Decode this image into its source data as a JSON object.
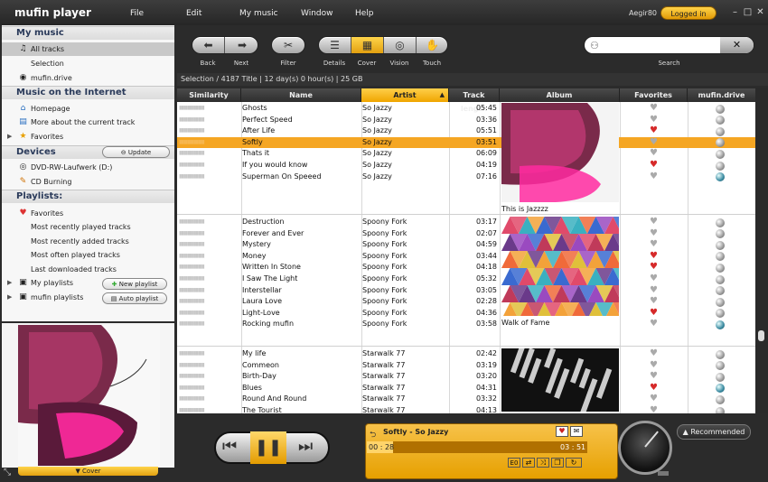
{
  "app": {
    "title": "mufin player",
    "user": "Aegir80",
    "logged_in": "Logged in"
  },
  "menu": [
    "File",
    "Edit",
    "My music",
    "Window",
    "Help"
  ],
  "toolbar": {
    "back": "Back",
    "next": "Next",
    "filter": "Filter",
    "details": "Details",
    "cover": "Cover",
    "vision": "Vision",
    "touch": "Touch",
    "search": "Search",
    "search_value": ""
  },
  "sidebar": {
    "my_music": "My music",
    "all_tracks": "All tracks",
    "selection": "Selection",
    "mufin_drive": "mufin.drive",
    "internet": "Music on the Internet",
    "homepage": "Homepage",
    "more_about": "More about the current track",
    "favorites": "Favorites",
    "devices": "Devices",
    "update": "Update",
    "dvd": "DVD-RW-Laufwerk (D:)",
    "cd": "CD Burning",
    "playlists": "Playlists:",
    "pl_favorites": "Favorites",
    "recent_played": "Most recently played tracks",
    "recent_added": "Most recently added tracks",
    "often_played": "Most often played tracks",
    "last_downloaded": "Last downloaded tracks",
    "my_playlists": "My playlists",
    "new_playlist": "New playlist",
    "mufin_playlists": "mufin playlists",
    "auto_playlist": "Auto playlist",
    "cover_label": "Cover"
  },
  "breadcrumb": [
    "Selection",
    "4187 Title",
    "12 day(s) 0 hour(s)",
    "25 GB"
  ],
  "columns": [
    "Similarity",
    "Name",
    "Artist",
    "Track length",
    "Album",
    "Favorites",
    "mufin.drive"
  ],
  "groups": [
    {
      "album": "This is Jazzzz",
      "tracks": [
        {
          "name": "Ghosts",
          "artist": "So Jazzy",
          "length": "05:45",
          "fav": false,
          "drive": "gray"
        },
        {
          "name": "Perfect Speed",
          "artist": "So Jazzy",
          "length": "03:36",
          "fav": false,
          "drive": "gray"
        },
        {
          "name": "After Life",
          "artist": "So Jazzy",
          "length": "05:51",
          "fav": true,
          "drive": "gray"
        },
        {
          "name": "Softly",
          "artist": "So Jazzy",
          "length": "03:51",
          "fav": false,
          "drive": "gray",
          "selected": true
        },
        {
          "name": "Thats it",
          "artist": "So Jazzy",
          "length": "06:09",
          "fav": false,
          "drive": "gray"
        },
        {
          "name": "If you would know",
          "artist": "So Jazzy",
          "length": "04:19",
          "fav": true,
          "drive": "gray"
        },
        {
          "name": "Superman On Speeed",
          "artist": "So Jazzy",
          "length": "07:16",
          "fav": false,
          "drive": "blue"
        }
      ]
    },
    {
      "album": "Walk of Fame",
      "tracks": [
        {
          "name": "Destruction",
          "artist": "Spoony Fork",
          "length": "03:17",
          "fav": false,
          "drive": "gray"
        },
        {
          "name": "Forever and Ever",
          "artist": "Spoony Fork",
          "length": "02:07",
          "fav": false,
          "drive": "gray"
        },
        {
          "name": "Mystery",
          "artist": "Spoony Fork",
          "length": "04:59",
          "fav": false,
          "drive": "gray"
        },
        {
          "name": "Money",
          "artist": "Spoony Fork",
          "length": "03:44",
          "fav": true,
          "drive": "gray"
        },
        {
          "name": "Written In Stone",
          "artist": "Spoony Fork",
          "length": "04:18",
          "fav": true,
          "drive": "gray"
        },
        {
          "name": "I Saw The Light",
          "artist": "Spoony Fork",
          "length": "05:32",
          "fav": false,
          "drive": "gray"
        },
        {
          "name": "Interstellar",
          "artist": "Spoony Fork",
          "length": "03:05",
          "fav": false,
          "drive": "gray"
        },
        {
          "name": "Laura Love",
          "artist": "Spoony Fork",
          "length": "02:28",
          "fav": false,
          "drive": "gray"
        },
        {
          "name": "Light-Love",
          "artist": "Spoony Fork",
          "length": "04:36",
          "fav": true,
          "drive": "gray"
        },
        {
          "name": "Rocking mufin",
          "artist": "Spoony Fork",
          "length": "03:58",
          "fav": false,
          "drive": "blue"
        }
      ]
    },
    {
      "album": "",
      "tracks": [
        {
          "name": "My life",
          "artist": "Starwalk 77",
          "length": "02:42",
          "fav": false,
          "drive": "gray"
        },
        {
          "name": "Commeon",
          "artist": "Starwalk 77",
          "length": "03:19",
          "fav": false,
          "drive": "gray"
        },
        {
          "name": "Birth-Day",
          "artist": "Starwalk 77",
          "length": "03:20",
          "fav": false,
          "drive": "gray"
        },
        {
          "name": "Blues",
          "artist": "Starwalk 77",
          "length": "04:31",
          "fav": true,
          "drive": "blue"
        },
        {
          "name": "Round And Round",
          "artist": "Starwalk 77",
          "length": "03:32",
          "fav": false,
          "drive": "gray"
        },
        {
          "name": "The Tourist",
          "artist": "Starwalk 77",
          "length": "04:13",
          "fav": false,
          "drive": "gray"
        }
      ]
    }
  ],
  "player": {
    "now_playing": "Softly - So Jazzy",
    "elapsed": "00 : 28",
    "total": "03 : 51",
    "progress": 0.12,
    "eq_label": "E0",
    "recommended": "Recommended"
  }
}
